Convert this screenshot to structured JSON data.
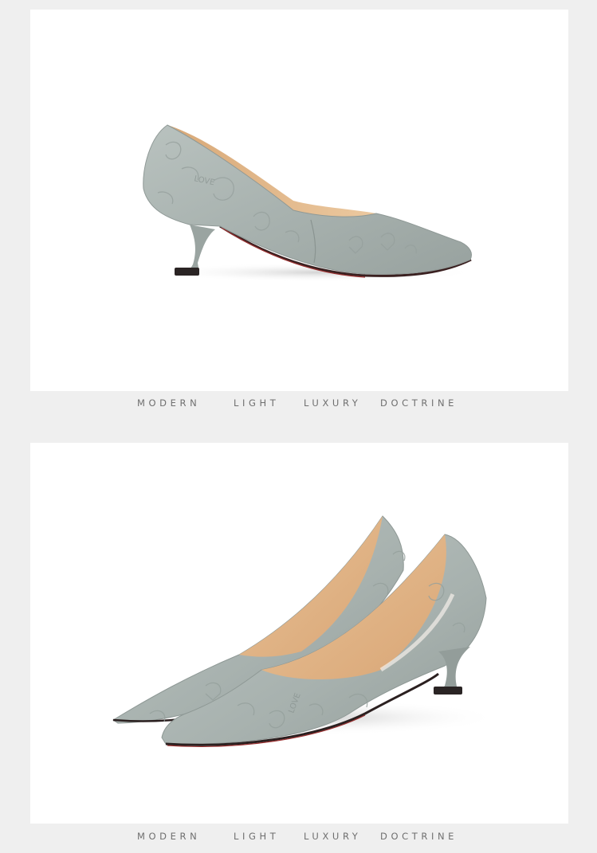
{
  "captions": [
    {
      "words": [
        "MODERN",
        "LIGHT",
        "LUXURY",
        "DOCTRINE"
      ]
    },
    {
      "words": [
        "MODERN",
        "LIGHT",
        "LUXURY",
        "DOCTRINE"
      ]
    }
  ],
  "photos": [
    {
      "subject": "shoe-side-view"
    },
    {
      "subject": "shoe-pair-angled-view"
    }
  ],
  "colors": {
    "background": "#efefef",
    "panel": "#ffffff",
    "leather": "#a9b3b0",
    "lining": "#e2b688",
    "sole": "#2b2020",
    "caption_text": "#6f6f6f"
  }
}
